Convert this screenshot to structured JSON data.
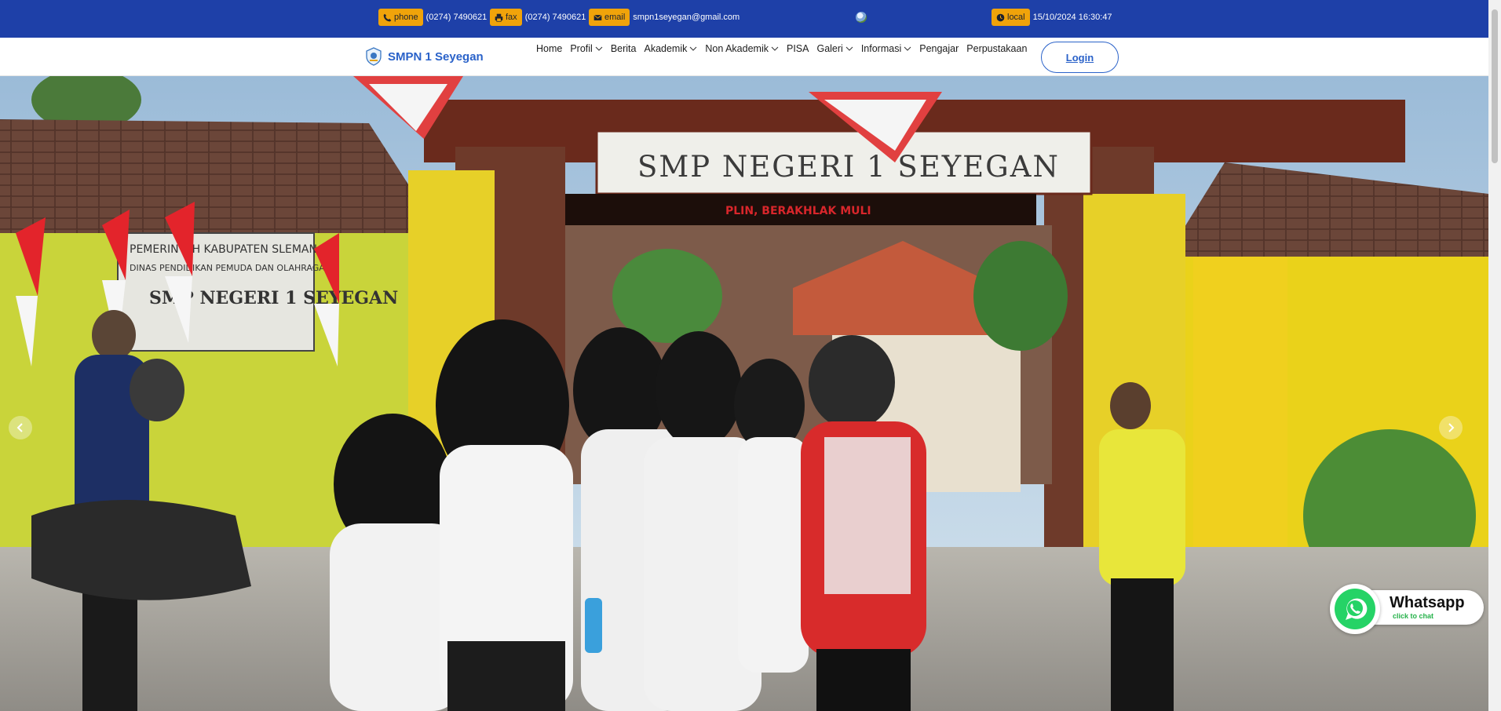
{
  "topbar": {
    "phone": {
      "badge": "phone",
      "icon": "phone-icon",
      "value": "(0274) 7490621"
    },
    "fax": {
      "badge": "fax",
      "icon": "fax-icon",
      "value": "(0274) 7490621"
    },
    "email": {
      "badge": "email",
      "icon": "envelope-icon",
      "value": "smpn1seyegan@gmail.com"
    },
    "local": {
      "badge": "local",
      "icon": "clock-icon",
      "value": "15/10/2024 16:30:47"
    },
    "bg_color": "#1e40a8",
    "badge_color": "#f0a30a"
  },
  "navbar": {
    "brand": "SMPN 1 Seyegan",
    "brand_color": "#2a62c9",
    "items": [
      {
        "label": "Home",
        "dropdown": false
      },
      {
        "label": "Profil",
        "dropdown": true
      },
      {
        "label": "Berita",
        "dropdown": false
      },
      {
        "label": "Akademik",
        "dropdown": true
      },
      {
        "label": "Non Akademik",
        "dropdown": true
      },
      {
        "label": "PISA",
        "dropdown": false
      },
      {
        "label": "Galeri",
        "dropdown": true
      },
      {
        "label": "Informasi",
        "dropdown": true
      },
      {
        "label": "Pengajar",
        "dropdown": false
      },
      {
        "label": "Perpustakaan",
        "dropdown": false
      }
    ],
    "login": "Login"
  },
  "hero": {
    "gate_sign": "SMP NEGERI 1 SEYEGAN",
    "gate_slogan": "PLIN, BERAKHLAK MULI",
    "wall_sign": [
      "PEMERINTAH KABUPATEN SLEMAN",
      "DINAS PENDIDIKAN PEMUDA DAN OLAHRAGA",
      "SMP NEGERI 1 SEYEGAN"
    ],
    "prev_icon": "chevron-left-icon",
    "next_icon": "chevron-right-icon"
  },
  "whatsapp": {
    "title": "Whatsapp",
    "subtitle": "click to chat",
    "icon": "whatsapp-icon",
    "color": "#25d366"
  }
}
